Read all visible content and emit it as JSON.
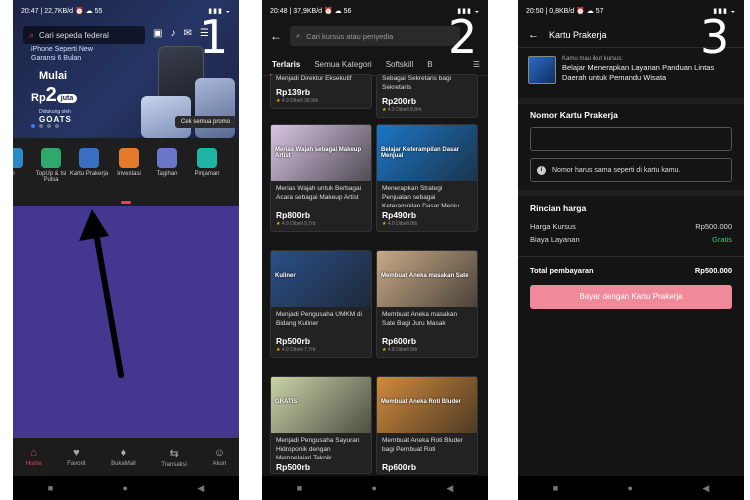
{
  "screens": [
    {
      "step_number": "1",
      "status_bar": {
        "time": "20:47",
        "speed": "22,7KB/d",
        "battery": "55"
      },
      "search_placeholder": "Cari sepeda federal",
      "promo": {
        "line1": "iPhone Seperti New",
        "line2": "Garansi 6 Bulan",
        "line3": "Mulai",
        "line4_prefix": "Rp",
        "line4_big": "2",
        "line4_pill": "juta",
        "line5": "Didukung oleh",
        "line6": "GOATS",
        "button": "Cek semua promo"
      },
      "menu": [
        {
          "label": "h",
          "color": "#2b8ac7"
        },
        {
          "label": "TopUp & Isi Pulsa",
          "color": "#2fa86b"
        },
        {
          "label": "Kartu Prakerja",
          "color": "#3b6fc2"
        },
        {
          "label": "Investasi",
          "color": "#e57b2a"
        },
        {
          "label": "Tagihan",
          "color": "#6a77c9"
        },
        {
          "label": "Pinjaman",
          "color": "#1fb5a4"
        }
      ],
      "bottom_nav": [
        {
          "label": "Home",
          "icon": "home-icon",
          "glyph": "⌂",
          "active": true
        },
        {
          "label": "Favorit",
          "icon": "heart-icon",
          "glyph": "♥",
          "active": false
        },
        {
          "label": "BukaMall",
          "icon": "bukamall-icon",
          "glyph": "♦",
          "active": false
        },
        {
          "label": "Transaksi",
          "icon": "transaction-icon",
          "glyph": "⇆",
          "active": false
        },
        {
          "label": "Akun",
          "icon": "account-icon",
          "glyph": "☺",
          "active": false
        }
      ]
    },
    {
      "step_number": "2",
      "status_bar": {
        "time": "20:48",
        "speed": "37,9KB/d",
        "battery": "56"
      },
      "search_placeholder": "Cari kursus atau penyedia",
      "tabs": [
        "Terlaris",
        "Semua Kategori",
        "Softskill",
        "B"
      ],
      "courses": [
        {
          "title": "Menjadi Direktur Eksekutif",
          "price": "Rp139rb",
          "rating": "4.9",
          "sold": "Dibeli 36,9rb",
          "color": "#b7bac6"
        },
        {
          "title": "Sebagai Sekretaris bagi Sekretaris",
          "price": "Rp200rb",
          "rating": "4.9",
          "sold": "Dibeli 8,8rb",
          "color": "#c9c3b9"
        },
        {
          "title": "Merias Wajah untuk Berbagai Acara sebagai Makeup Artist",
          "price": "Rp800rb",
          "rating": "4.9",
          "sold": "Dibeli 9,7rb",
          "color": "#d8c6e4",
          "banner": "Merias Wajah sebagai Makeup Artist"
        },
        {
          "title": "Menerapkan Strategi Penjualan sebagai Keterampilan Dasar Menju...",
          "price": "Rp490rb",
          "rating": "4.8",
          "sold": "Dibeli 8rb",
          "color": "#1b76c7",
          "banner": "Belajar Keterampilan Dasar Menjual"
        },
        {
          "title": "Menjadi Pengusaha UMKM di Bidang Kuliner",
          "price": "Rp500rb",
          "rating": "4.9",
          "sold": "Dibeli 7,7rb",
          "color": "#2a4f88",
          "banner": "Kuliner"
        },
        {
          "title": "Membuat Aneka masakan Sate Bagi Juru Masak",
          "price": "Rp600rb",
          "rating": "4.8",
          "sold": "Dibeli 8rb",
          "color": "#c7a987",
          "banner": "Membuat Aneka masakan Sate"
        },
        {
          "title": "Menjadi Pengusaha Sayuran Hidroponik dengan Mempelajari Teknik...",
          "price": "Rp500rb",
          "rating": "",
          "sold": "",
          "color": "#c9d4a8",
          "banner": "GRATIS"
        },
        {
          "title": "Membuat Aneka Roti Bluder bagi Pembuat Roti",
          "price": "Rp600rb",
          "rating": "",
          "sold": "",
          "color": "#d08a3d",
          "banner": "Membuat Aneka Roti Bluder"
        }
      ]
    },
    {
      "step_number": "3",
      "status_bar": {
        "time": "20:50",
        "speed": "0,8KB/d",
        "battery": "57"
      },
      "title": "Kartu Prakerja",
      "course_caption": "Kamu mau ikut kursus:",
      "course_name": "Belajar Menerapkan Layanan Panduan Lintas Daerah untuk Pemandu Wisata",
      "card_number_label": "Nomor Kartu Prakerja",
      "card_number_value": "",
      "note": "Nomor harus sama seperti di kartu kamu.",
      "pricing_label": "Rincian harga",
      "price_rows": [
        {
          "label": "Harga Kursus",
          "value": "Rp500.000"
        },
        {
          "label": "Biaya Layanan",
          "value": "Gratis"
        }
      ],
      "total_label": "Total pembayaran",
      "total_value": "Rp500.000",
      "pay_button": "Bayar dengan Kartu Prakerja"
    }
  ],
  "colors": {
    "accent": "#e8425a",
    "free": "#3cc27a",
    "arrow": "#000000",
    "purple": "#43378f"
  }
}
